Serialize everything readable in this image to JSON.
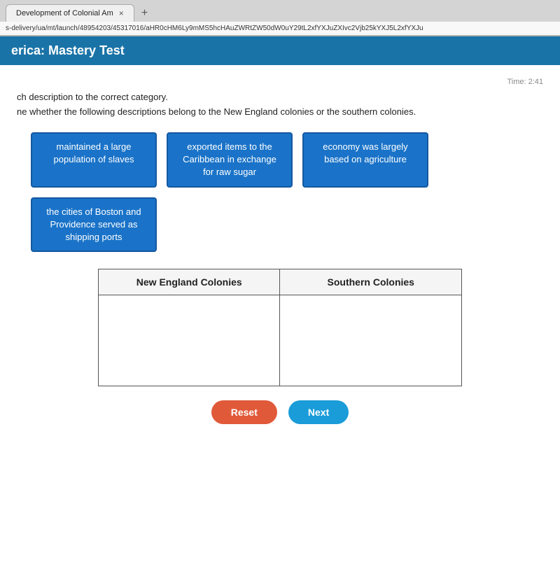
{
  "browser": {
    "tab_label": "Development of Colonial Am",
    "tab_close": "×",
    "tab_add": "+",
    "address": "s-delivery/ua/mt/launch/48954203/45317016/aHR0cHM6Ly9mMS5hcHAuZWRtZW50dW0uY29tL2xfYXJuZXIvc2Vjb25kYXJ5L2xfYXJu"
  },
  "header": {
    "title": "erica: Mastery Test"
  },
  "instructions": {
    "primary": "ch description to the correct category.",
    "secondary": "ne whether the following descriptions belong to the New England colonies or the southern colonies."
  },
  "timer": "Time: 2:41",
  "drag_items": [
    {
      "id": "item1",
      "text": "maintained a large population of slaves"
    },
    {
      "id": "item2",
      "text": "exported items to the Caribbean in exchange for raw sugar"
    },
    {
      "id": "item3",
      "text": "economy was largely based on agriculture"
    },
    {
      "id": "item4",
      "text": "the cities of Boston and Providence served as shipping ports"
    }
  ],
  "table": {
    "col1_header": "New England Colonies",
    "col2_header": "Southern Colonies"
  },
  "buttons": {
    "reset": "Reset",
    "next": "Next"
  }
}
